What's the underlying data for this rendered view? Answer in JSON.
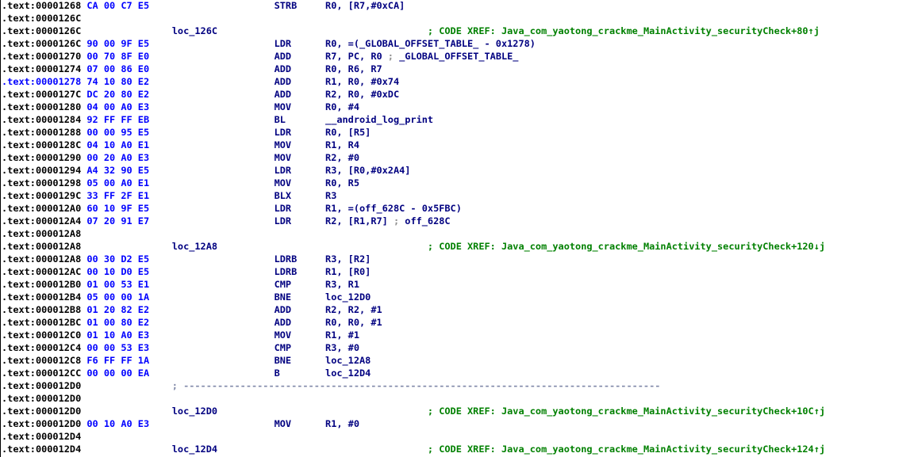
{
  "colors": {
    "address": "#000000",
    "current_address": "#0000ff",
    "bytes": "#0000ff",
    "mnemonic": "#000080",
    "immediate": "#008000",
    "comment": "#008000"
  },
  "rows": [
    {
      "addr": ".text:00001268",
      "bytes": "CA 00 C7 E5",
      "mnem": "STRB",
      "ops": "R0, [R7,#0xCA]"
    },
    {
      "addr": ".text:0000126C"
    },
    {
      "addr": ".text:0000126C",
      "label": "loc_126C",
      "comment": "; CODE XREF: Java_com_yaotong_crackme_MainActivity_securityCheck+80↑j"
    },
    {
      "addr": ".text:0000126C",
      "bytes": "90 00 9F E5",
      "mnem": "LDR",
      "ops": "R0, =(_GLOBAL_OFFSET_TABLE_ - 0x1278)"
    },
    {
      "addr": ".text:00001270",
      "bytes": "00 70 8F E0",
      "mnem": "ADD",
      "ops": "R7, PC, R0",
      "ops_comment": "; _GLOBAL_OFFSET_TABLE_"
    },
    {
      "addr": ".text:00001274",
      "bytes": "07 00 86 E0",
      "mnem": "ADD",
      "ops": "R0, R6, R7"
    },
    {
      "addr": ".text:00001278",
      "bytes": "74 10 80 E2",
      "mnem": "ADD",
      "ops": "R1, R0, #0x74",
      "current": true
    },
    {
      "addr": ".text:0000127C",
      "bytes": "DC 20 80 E2",
      "mnem": "ADD",
      "ops": "R2, R0, #0xDC"
    },
    {
      "addr": ".text:00001280",
      "bytes": "04 00 A0 E3",
      "mnem": "MOV",
      "ops": "R0, #4"
    },
    {
      "addr": ".text:00001284",
      "bytes": "92 FF FF EB",
      "mnem": "BL",
      "ops": "__android_log_print"
    },
    {
      "addr": ".text:00001288",
      "bytes": "00 00 95 E5",
      "mnem": "LDR",
      "ops": "R0, [R5]"
    },
    {
      "addr": ".text:0000128C",
      "bytes": "04 10 A0 E1",
      "mnem": "MOV",
      "ops": "R1, R4"
    },
    {
      "addr": ".text:00001290",
      "bytes": "00 20 A0 E3",
      "mnem": "MOV",
      "ops": "R2, #0"
    },
    {
      "addr": ".text:00001294",
      "bytes": "A4 32 90 E5",
      "mnem": "LDR",
      "ops": "R3, [R0,#0x2A4]"
    },
    {
      "addr": ".text:00001298",
      "bytes": "05 00 A0 E1",
      "mnem": "MOV",
      "ops": "R0, R5"
    },
    {
      "addr": ".text:0000129C",
      "bytes": "33 FF 2F E1",
      "mnem": "BLX",
      "ops": "R3"
    },
    {
      "addr": ".text:000012A0",
      "bytes": "60 10 9F E5",
      "mnem": "LDR",
      "ops": "R1, =(off_628C - 0x5FBC)"
    },
    {
      "addr": ".text:000012A4",
      "bytes": "07 20 91 E7",
      "mnem": "LDR",
      "ops": "R2, [R1,R7]",
      "ops_comment": "; off_628C"
    },
    {
      "addr": ".text:000012A8"
    },
    {
      "addr": ".text:000012A8",
      "label": "loc_12A8",
      "comment": "; CODE XREF: Java_com_yaotong_crackme_MainActivity_securityCheck+120↓j"
    },
    {
      "addr": ".text:000012A8",
      "bytes": "00 30 D2 E5",
      "mnem": "LDRB",
      "ops": "R3, [R2]"
    },
    {
      "addr": ".text:000012AC",
      "bytes": "00 10 D0 E5",
      "mnem": "LDRB",
      "ops": "R1, [R0]"
    },
    {
      "addr": ".text:000012B0",
      "bytes": "01 00 53 E1",
      "mnem": "CMP",
      "ops": "R3, R1"
    },
    {
      "addr": ".text:000012B4",
      "bytes": "05 00 00 1A",
      "mnem": "BNE",
      "ops": "loc_12D0"
    },
    {
      "addr": ".text:000012B8",
      "bytes": "01 20 82 E2",
      "mnem": "ADD",
      "ops": "R2, R2, #1"
    },
    {
      "addr": ".text:000012BC",
      "bytes": "01 00 80 E2",
      "mnem": "ADD",
      "ops": "R0, R0, #1"
    },
    {
      "addr": ".text:000012C0",
      "bytes": "01 10 A0 E3",
      "mnem": "MOV",
      "ops": "R1, #1"
    },
    {
      "addr": ".text:000012C4",
      "bytes": "00 00 53 E3",
      "mnem": "CMP",
      "ops": "R3, #0"
    },
    {
      "addr": ".text:000012C8",
      "bytes": "F6 FF FF 1A",
      "mnem": "BNE",
      "ops": "loc_12A8"
    },
    {
      "addr": ".text:000012CC",
      "bytes": "00 00 00 EA",
      "mnem": "B",
      "ops": "loc_12D4"
    },
    {
      "addr": ".text:000012D0",
      "separator": "; ------------------------------------------------------------------------------------"
    },
    {
      "addr": ".text:000012D0"
    },
    {
      "addr": ".text:000012D0",
      "label": "loc_12D0",
      "comment": "; CODE XREF: Java_com_yaotong_crackme_MainActivity_securityCheck+10C↑j"
    },
    {
      "addr": ".text:000012D0",
      "bytes": "00 10 A0 E3",
      "mnem": "MOV",
      "ops": "R1, #0"
    },
    {
      "addr": ".text:000012D4"
    },
    {
      "addr": ".text:000012D4",
      "label": "loc_12D4",
      "comment": "; CODE XREF: Java_com_yaotong_crackme_MainActivity_securityCheck+124↑j"
    }
  ]
}
